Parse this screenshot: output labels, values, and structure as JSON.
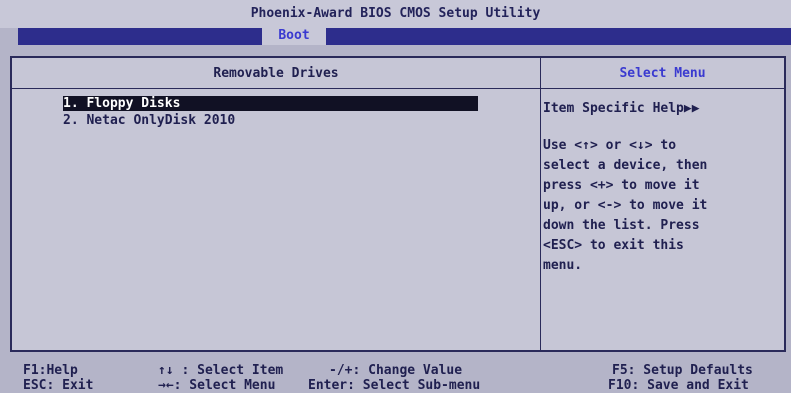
{
  "title": "Phoenix-Award BIOS CMOS Setup Utility",
  "menu": {
    "active_tab": "Boot"
  },
  "left_panel": {
    "header": "Removable Drives",
    "items": [
      {
        "label": "1. Floppy Disks",
        "selected": true
      },
      {
        "label": "2. Netac OnlyDisk 2010",
        "selected": false
      }
    ]
  },
  "right_panel": {
    "header": "Select Menu",
    "help_title": "Item Specific Help▶▶",
    "help_text": "Use <↑> or <↓> to\nselect a device, then\npress <+> to move it\nup, or <-> to move it\ndown the list. Press\n<ESC> to exit this\nmenu."
  },
  "footer": {
    "row1": [
      "F1:Help",
      "↑↓ : Select Item",
      "-/+: Change Value",
      "F5: Setup Defaults"
    ],
    "row2": [
      "ESC: Exit",
      "→←: Select Menu",
      "Enter: Select Sub-menu",
      "F10: Save and Exit"
    ]
  },
  "colors": {
    "background": "#b4b4c8",
    "menu_bar": "#2d2d8c",
    "highlight": "#111124",
    "accent": "#3a3ad0"
  }
}
